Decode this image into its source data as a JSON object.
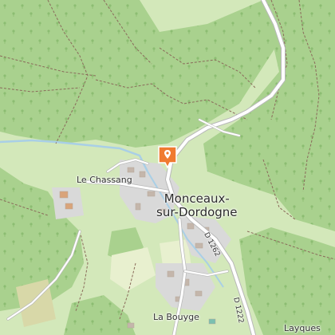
{
  "map": {
    "places": {
      "town_line1": "Monceaux-",
      "town_line2": "sur-Dordogne",
      "le_chassang": "Le Chassang",
      "la_bouyge": "La Bouyge",
      "layques": "Layques"
    },
    "road_refs": {
      "d1262": "D 1262",
      "d1222": "D 1222"
    },
    "marker": {
      "icon": "location-pin-icon",
      "color": "#f07a30"
    },
    "colors": {
      "forest": "#a9d18e",
      "meadow": "#d3e8ba",
      "residential": "#d9d9d9",
      "road": "#ffffff",
      "river": "#a9cfe6",
      "path": "#8a6a5a"
    }
  }
}
